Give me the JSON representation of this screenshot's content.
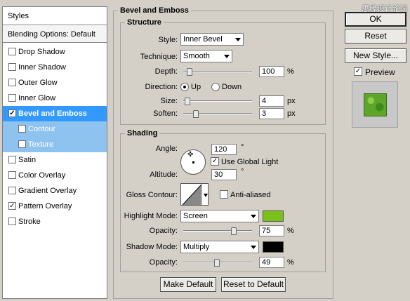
{
  "styles_panel": {
    "header": "Styles",
    "blending_options": "Blending Options: Default",
    "items": [
      {
        "label": "Drop Shadow",
        "checked": false
      },
      {
        "label": "Inner Shadow",
        "checked": false
      },
      {
        "label": "Outer Glow",
        "checked": false
      },
      {
        "label": "Inner Glow",
        "checked": false
      },
      {
        "label": "Bevel and Emboss",
        "checked": true,
        "selected": true
      },
      {
        "label": "Contour",
        "checked": false,
        "sub": true
      },
      {
        "label": "Texture",
        "checked": false,
        "sub": true
      },
      {
        "label": "Satin",
        "checked": false
      },
      {
        "label": "Color Overlay",
        "checked": false
      },
      {
        "label": "Gradient Overlay",
        "checked": false
      },
      {
        "label": "Pattern Overlay",
        "checked": true
      },
      {
        "label": "Stroke",
        "checked": false
      }
    ]
  },
  "watermark": {
    "line1": "思缘设计论坛",
    "line2": "www.missyuan.com"
  },
  "bevel": {
    "title": "Bevel and Emboss",
    "structure": {
      "title": "Structure",
      "style_label": "Style:",
      "style_value": "Inner Bevel",
      "technique_label": "Technique:",
      "technique_value": "Smooth",
      "depth_label": "Depth:",
      "depth_value": "100",
      "depth_unit": "%",
      "depth_level": 0.05,
      "direction_label": "Direction:",
      "direction_up": "Up",
      "direction_down": "Down",
      "direction_selected": "Up",
      "size_label": "Size:",
      "size_value": "4",
      "size_unit": "px",
      "size_level": 0.02,
      "soften_label": "Soften:",
      "soften_value": "3",
      "soften_unit": "px",
      "soften_level": 0.15
    },
    "shading": {
      "title": "Shading",
      "angle_label": "Angle:",
      "angle_value": "120",
      "angle_unit": "°",
      "use_global_light_label": "Use Global Light",
      "use_global_light_checked": true,
      "altitude_label": "Altitude:",
      "altitude_value": "30",
      "altitude_unit": "°",
      "gloss_contour_label": "Gloss Contour:",
      "anti_aliased_label": "Anti-aliased",
      "anti_aliased_checked": false,
      "highlight_mode_label": "Highlight Mode:",
      "highlight_mode_value": "Screen",
      "highlight_color": "#7cc11a",
      "highlight_opacity_label": "Opacity:",
      "highlight_opacity_value": "75",
      "highlight_opacity_unit": "%",
      "highlight_opacity_level": 0.75,
      "shadow_mode_label": "Shadow Mode:",
      "shadow_mode_value": "Multiply",
      "shadow_color": "#000000",
      "shadow_opacity_label": "Opacity:",
      "shadow_opacity_value": "49",
      "shadow_opacity_unit": "%",
      "shadow_opacity_level": 0.49
    },
    "make_default": "Make Default",
    "reset_default": "Reset to Default"
  },
  "actions": {
    "ok": "OK",
    "reset": "Reset",
    "new_style": "New Style...",
    "preview_label": "Preview",
    "preview_checked": true
  },
  "colors": {
    "selected": "#3399ff",
    "sub_selected": "#8fc3ef"
  }
}
